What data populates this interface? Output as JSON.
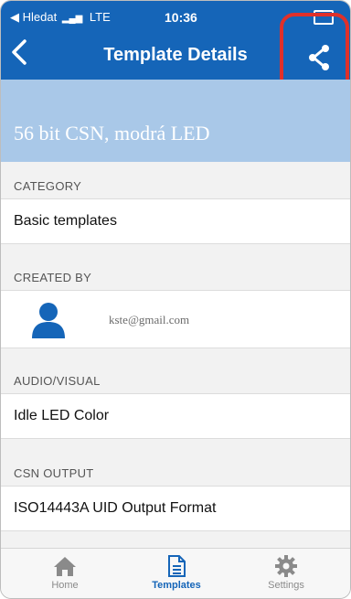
{
  "status": {
    "carrier": "◀ Hledat",
    "signal": "▂▄▆",
    "network": "LTE",
    "time": "10:36"
  },
  "nav": {
    "title": "Template Details"
  },
  "hero": {
    "name": "56 bit CSN, modrá LED"
  },
  "sections": {
    "category": {
      "label": "CATEGORY",
      "value": "Basic templates"
    },
    "created_by": {
      "label": "CREATED BY",
      "email": "kste@gmail.com"
    },
    "audio_visual": {
      "label": "AUDIO/VISUAL",
      "value": "Idle LED Color"
    },
    "csn_output": {
      "label": "CSN OUTPUT",
      "value": "ISO14443A UID Output Format"
    }
  },
  "tabs": [
    {
      "label": "Home",
      "icon": "home-icon"
    },
    {
      "label": "Templates",
      "icon": "document-icon"
    },
    {
      "label": "Settings",
      "icon": "gear-icon"
    }
  ],
  "colors": {
    "accent": "#1565b8",
    "hero": "#a9c8e8",
    "highlight": "#e0302a"
  }
}
